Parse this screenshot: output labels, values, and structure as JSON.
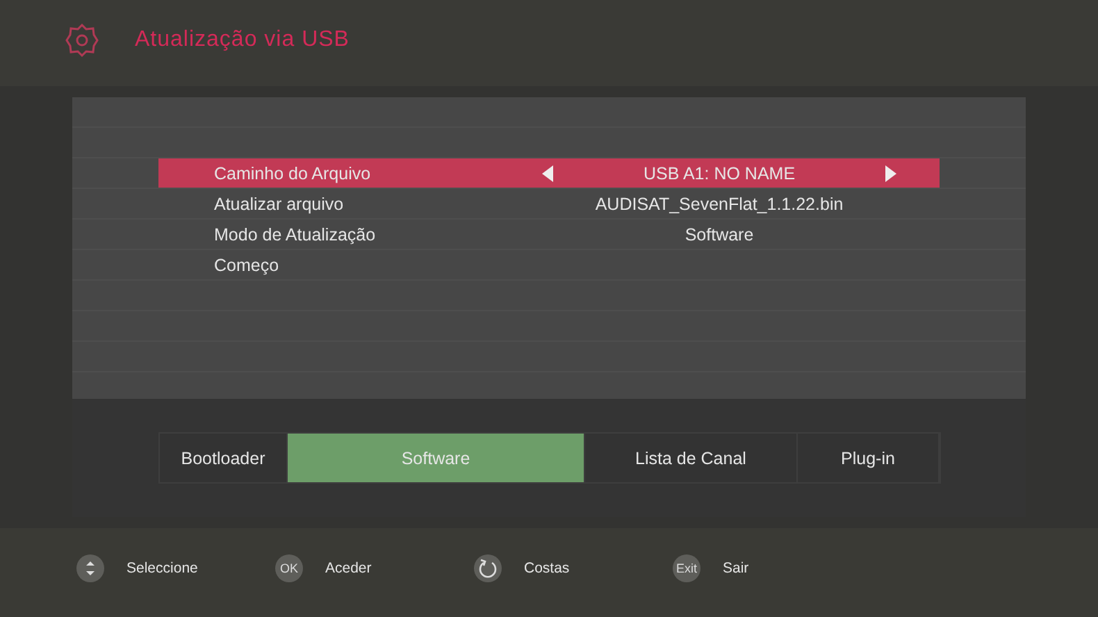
{
  "header": {
    "title": "Atualização via USB"
  },
  "settings": [
    {
      "label": "Caminho do Arquivo",
      "value": "USB A1: NO NAME",
      "selected": true
    },
    {
      "label": "Atualizar arquivo",
      "value": "AUDISAT_SevenFlat_1.1.22.bin",
      "selected": false
    },
    {
      "label": "Modo de Atualização",
      "value": "Software",
      "selected": false
    },
    {
      "label": "Começo",
      "selected": false
    }
  ],
  "tabs": [
    {
      "label": "Bootloader",
      "selected": false
    },
    {
      "label": "Software",
      "selected": true
    },
    {
      "label": "Lista de Canal",
      "selected": false
    },
    {
      "label": "Plug-in",
      "selected": false
    }
  ],
  "hints": [
    {
      "kind": "updown",
      "label": "Seleccione"
    },
    {
      "kind": "key",
      "key": "OK",
      "label": "Aceder"
    },
    {
      "kind": "back",
      "label": "Costas"
    },
    {
      "kind": "key",
      "key": "Exit",
      "label": "Sair"
    }
  ]
}
